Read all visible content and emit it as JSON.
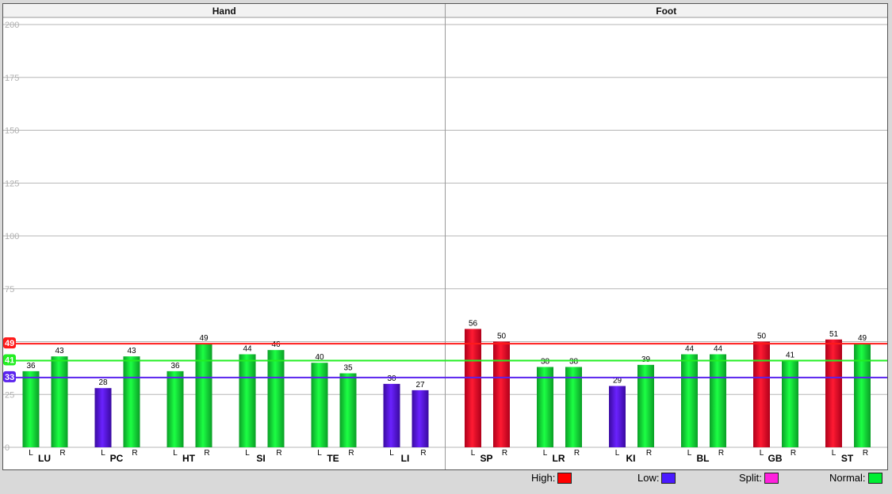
{
  "chart_data": {
    "type": "bar",
    "sections": [
      {
        "name": "Hand",
        "meridians": [
          {
            "name": "LU",
            "values": [
              36,
              43
            ]
          },
          {
            "name": "PC",
            "values": [
              28,
              43
            ]
          },
          {
            "name": "HT",
            "values": [
              36,
              49
            ]
          },
          {
            "name": "SI",
            "values": [
              44,
              46
            ]
          },
          {
            "name": "TE",
            "values": [
              40,
              35
            ]
          },
          {
            "name": "LI",
            "values": [
              30,
              27
            ]
          }
        ]
      },
      {
        "name": "Foot",
        "meridians": [
          {
            "name": "SP",
            "values": [
              56,
              50
            ]
          },
          {
            "name": "LR",
            "values": [
              38,
              38
            ]
          },
          {
            "name": "KI",
            "values": [
              29,
              39
            ]
          },
          {
            "name": "BL",
            "values": [
              44,
              44
            ]
          },
          {
            "name": "GB",
            "values": [
              50,
              41
            ]
          },
          {
            "name": "ST",
            "values": [
              51,
              49
            ]
          }
        ]
      }
    ],
    "side_labels": [
      "L",
      "R"
    ],
    "y_ticks": [
      0,
      25,
      50,
      75,
      100,
      125,
      150,
      175,
      200
    ],
    "ylim": [
      0,
      200
    ],
    "grid": true,
    "reference_lines": [
      {
        "name": "High",
        "value": 49,
        "color": "#ff1a1a"
      },
      {
        "name": "Normal",
        "value": 41,
        "color": "#22ee22"
      },
      {
        "name": "Low",
        "value": 33,
        "color": "#5a22ee"
      }
    ],
    "legend": [
      {
        "label": "High:",
        "color": "#ff0000"
      },
      {
        "label": "Low:",
        "color": "#4a1aff"
      },
      {
        "label": "Split:",
        "color": "#ff22dd"
      },
      {
        "label": "Normal:",
        "color": "#00ee33"
      }
    ],
    "legend_placement": "bottom"
  }
}
